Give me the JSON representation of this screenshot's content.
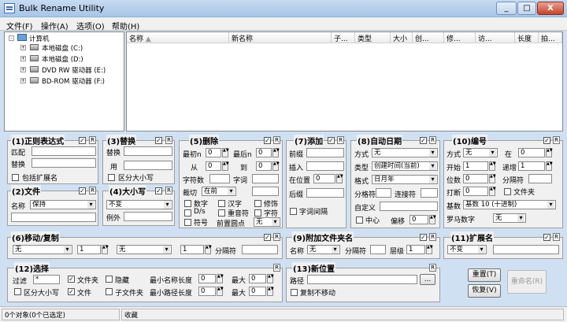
{
  "window": {
    "title": "Bulk Rename Utility",
    "min": "_",
    "max": "□",
    "close": "X"
  },
  "menu": [
    "文件(F)",
    "操作(A)",
    "选项(O)",
    "帮助(H)"
  ],
  "tree": {
    "root": "计算机",
    "drives": [
      "本地磁盘 (C:)",
      "本地磁盘 (D:)",
      "DVD RW 驱动器 (E:)",
      "BD-ROM 驱动器 (F:)"
    ]
  },
  "columns": [
    "名称",
    "新名称",
    "子...",
    "类型",
    "大小",
    "创...",
    "修...",
    "访...",
    "长度",
    "拍..."
  ],
  "regex": {
    "title": "(1)正则表达式",
    "match": "匹配",
    "replace": "替换",
    "include_ext": "包括扩展名"
  },
  "replace": {
    "title": "(3)替换",
    "replace": "替换",
    "with": "用",
    "case": "区分大小写"
  },
  "remove": {
    "title": "(5)删除",
    "first_n": "最初n",
    "last_n": "最后n",
    "from": "从",
    "to": "到",
    "chars": "字符数",
    "words": "字词",
    "crop": "裁切",
    "crop_val": "在前",
    "digits": "数字",
    "hanzi": "汉字",
    "trim": "修饰",
    "ds": "D/s",
    "dup": "重音符",
    "chars2": "字符",
    "sym": "符号",
    "lead_dots": "前置圆点",
    "lead_val": "无",
    "v0": "0",
    "v1": "0",
    "v2": "0",
    "v3": "0"
  },
  "add": {
    "title": "(7)添加",
    "prefix": "前缀",
    "insert": "插入",
    "at_pos": "在位置",
    "at_val": "0",
    "suffix": "后缀",
    "word_space": "字词间隔"
  },
  "autodate": {
    "title": "(8)自动日期",
    "mode": "方式",
    "mode_val": "无",
    "type": "类型",
    "type_val": "创建时间(当前)",
    "fmt": "格式",
    "fmt_val": "日月年",
    "sep": "分格符",
    "conn": "连接符",
    "custom": "自定义",
    "center": "中心",
    "offset": "偏移",
    "offset_val": "0"
  },
  "numbering": {
    "title": "(10)编号",
    "mode": "方式",
    "mode_val": "无",
    "at": "在",
    "at_val": "0",
    "start": "开始",
    "start_val": "1",
    "incr": "递增",
    "incr_val": "1",
    "pad": "位数",
    "pad_val": "0",
    "sep": "分隔符",
    "break": "打断",
    "break_val": "0",
    "folder": "文件夹",
    "base": "基数",
    "base_val": "基数 10 (十进制)",
    "roman": "罗马数字",
    "roman_val": "无"
  },
  "file": {
    "title": "(2)文件",
    "name": "名称",
    "name_val": "保持"
  },
  "case": {
    "title": "(4)大小写",
    "case_val": "不变",
    "except": "例外"
  },
  "move": {
    "title": "(6)移动/复制",
    "sel1": "无",
    "n1": "1",
    "sel2": "无",
    "n2": "1",
    "sep": "分隔符"
  },
  "appendfolder": {
    "title": "(9)附加文件夹名",
    "name": "名称",
    "name_val": "无",
    "sep": "分隔符",
    "levels": "层级",
    "levels_val": "1"
  },
  "ext": {
    "title": "(11)扩展名",
    "val": "不变"
  },
  "selection": {
    "title": "(12)选择",
    "filter": "过滤",
    "filter_val": "*",
    "folders": "文件夹",
    "hidden": "隐藏",
    "min_name": "最小名称长度",
    "max": "最大",
    "case": "区分大小写",
    "files": "文件",
    "subfolders": "子文件夹",
    "min_path": "最小路径长度",
    "max2": "最大",
    "v": "0"
  },
  "newloc": {
    "title": "(13)新位置",
    "path": "路径",
    "browse": "...",
    "copy": "复制不移动"
  },
  "buttons": {
    "reset": "重置(T)",
    "revert": "恢复(V)",
    "rename": "重命名(R)"
  },
  "status": {
    "objects": "0个对象(0个已选定)",
    "collapse": "收藏"
  },
  "r_label": "R",
  "check_mark": "✓"
}
